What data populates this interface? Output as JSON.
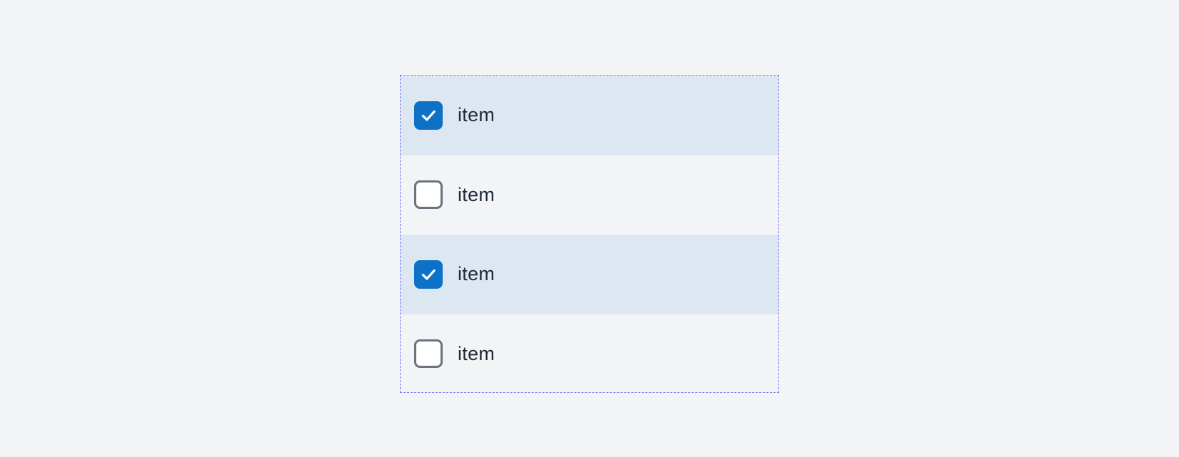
{
  "colors": {
    "page_background": "#f3f4f6",
    "selected_row_background": "#dce7f1",
    "checkbox_checked_fill": "#0d72c7",
    "checkbox_unchecked_border": "#6b7280",
    "dashed_outline": "#7b7bf3",
    "text": "#1f2937"
  },
  "list": {
    "items": [
      {
        "label": "item",
        "checked": true
      },
      {
        "label": "item",
        "checked": false
      },
      {
        "label": "item",
        "checked": true
      },
      {
        "label": "item",
        "checked": false
      }
    ]
  }
}
